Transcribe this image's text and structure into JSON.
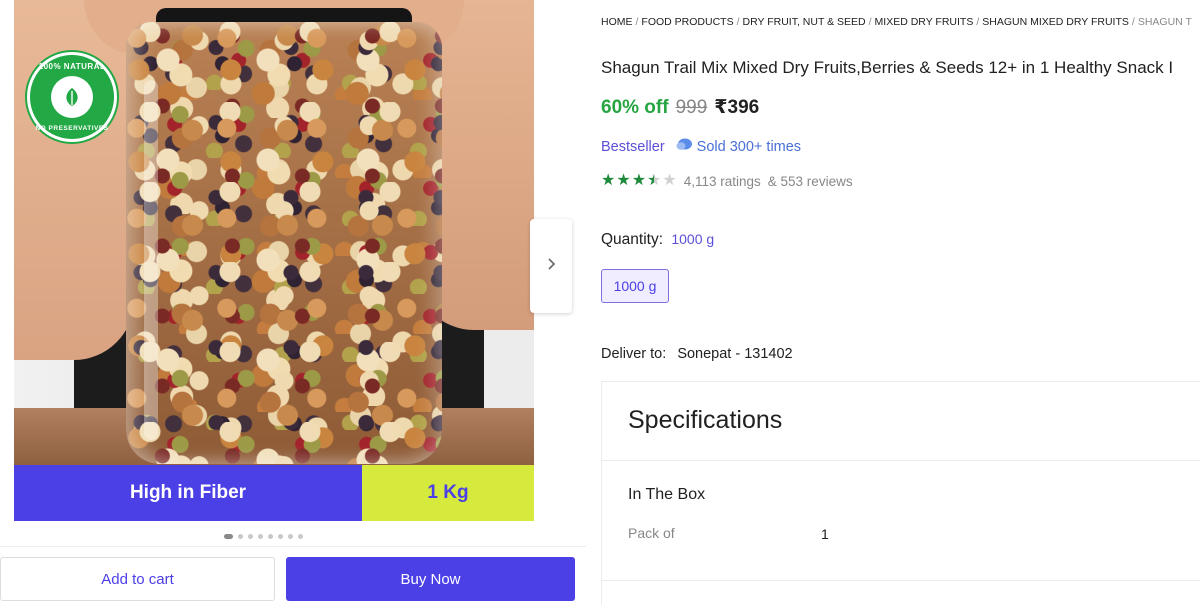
{
  "gallery": {
    "badge": {
      "top_text": "100% NATURAL",
      "bottom_text": "NO PRESERVATIVES",
      "icon": "leaf-icon"
    },
    "features": {
      "left": "High in Fiber",
      "right": "1 Kg"
    },
    "carousel": {
      "dot_count": 8,
      "active_index": 0
    },
    "next_icon": "chevron-right-icon"
  },
  "actions": {
    "add_to_cart": "Add to cart",
    "buy_now": "Buy Now"
  },
  "breadcrumb": [
    "HOME",
    "FOOD PRODUCTS",
    "DRY FRUIT, NUT & SEED",
    "MIXED DRY FRUITS",
    "SHAGUN MIXED DRY FRUITS",
    "SHAGUN T"
  ],
  "product": {
    "title": "Shagun Trail Mix Mixed Dry Fruits,Berries & Seeds 12+ in 1 Healthy Snack I",
    "discount": "60% off",
    "mrp": "999",
    "price": "₹396",
    "bestseller": "Bestseller",
    "sold": "Sold 300+ times",
    "rating_value": 3.5,
    "ratings": "4,113 ratings",
    "reviews": "& 553 reviews"
  },
  "quantity": {
    "label": "Quantity:",
    "value": "1000 g",
    "option": "1000 g"
  },
  "delivery": {
    "label": "Deliver to:",
    "location": "Sonepat - 131402"
  },
  "specifications": {
    "title": "Specifications",
    "group": "In The Box",
    "rows": [
      {
        "key": "Pack of",
        "value": "1"
      }
    ]
  },
  "colors": {
    "accent": "#4b3fe6",
    "discount": "#26a541",
    "feature_right": "#d6ea3d",
    "star": "#1f8a3b"
  }
}
